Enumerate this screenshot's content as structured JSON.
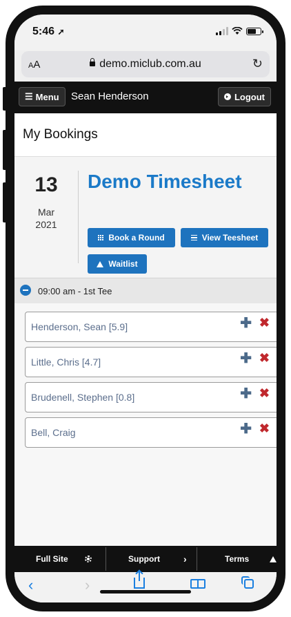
{
  "status": {
    "time": "5:46"
  },
  "browser": {
    "text_size_label_small": "A",
    "text_size_label_large": "A",
    "url": "demo.miclub.com.au"
  },
  "nav": {
    "menu_label": "Menu",
    "user_name": "Sean Henderson",
    "logout_label": "Logout"
  },
  "page": {
    "title": "My Bookings"
  },
  "booking": {
    "day": "13",
    "month": "Mar",
    "year": "2021",
    "event_title": "Demo Timesheet",
    "actions": {
      "book_round": "Book a Round",
      "view_teesheet": "View Teesheet",
      "waitlist": "Waitlist"
    },
    "tee_time": "09:00 am - 1st Tee",
    "players": [
      {
        "name": "Henderson, Sean [5.9]"
      },
      {
        "name": "Little, Chris [4.7]"
      },
      {
        "name": "Brudenell, Stephen [0.8]"
      },
      {
        "name": "Bell, Craig"
      }
    ]
  },
  "footer": {
    "full_site": "Full Site",
    "support": "Support",
    "terms": "Terms"
  },
  "colors": {
    "accent": "#1e73be",
    "title_blue": "#1b7ac8",
    "delete_red": "#c0282d",
    "nav_black": "#111111"
  }
}
